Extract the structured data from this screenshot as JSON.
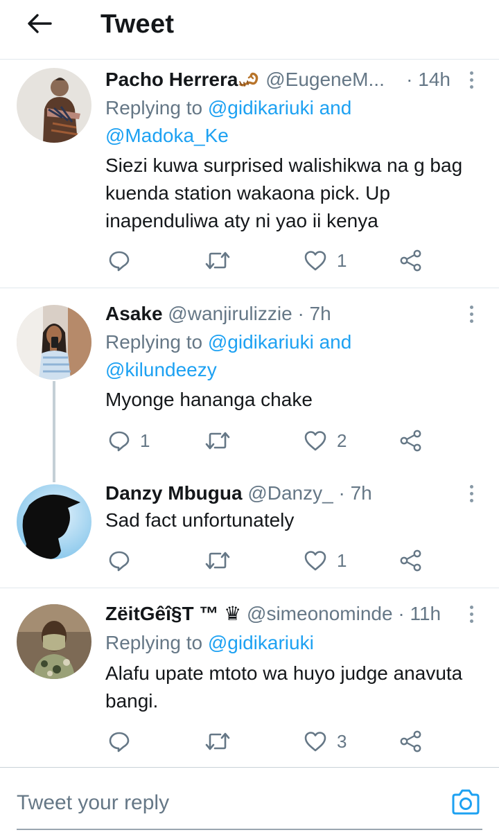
{
  "header": {
    "title": "Tweet",
    "back_icon": "arrow-left-icon"
  },
  "colors": {
    "link": "#1da1f2",
    "secondary_text": "#657786",
    "divider": "#e1e8ed"
  },
  "tweets": [
    {
      "name": "Pacho Herrera",
      "name_emoji": "scorpion-icon",
      "handle": "@EugeneM...",
      "time": "· 14h",
      "replying_prefix": "Replying to",
      "reply_links": [
        "@gidikariuki",
        "and",
        "@Madoka_Ke"
      ],
      "text": "Siezi kuwa surprised walishikwa na g bag kuenda station wakaona pick. Up inapenduliwa aty ni yao ii kenya",
      "counts": {
        "reply": "",
        "retweet": "",
        "like": "1"
      }
    },
    {
      "name": "Asake",
      "handle": "@wanjirulizzie",
      "time": "· 7h",
      "replying_prefix": "Replying to",
      "reply_links": [
        "@gidikariuki",
        "and",
        "@kilundeezy"
      ],
      "text": "Myonge hananga chake",
      "counts": {
        "reply": "1",
        "retweet": "",
        "like": "2"
      }
    },
    {
      "name": "Danzy Mbugua",
      "handle": "@Danzy_",
      "time": "· 7h",
      "text": "Sad fact unfortunately",
      "counts": {
        "reply": "",
        "retweet": "",
        "like": "1"
      }
    },
    {
      "name": "ZëitGêî§T ™ ♛",
      "handle": "@simeonominde",
      "time": "· 11h",
      "replying_prefix": "Replying to",
      "reply_links": [
        "@gidikariuki"
      ],
      "text": "Alafu upate mtoto wa huyo judge anavuta bangi.",
      "counts": {
        "reply": "",
        "retweet": "",
        "like": "3"
      }
    }
  ],
  "composer": {
    "placeholder": "Tweet your reply",
    "camera_icon": "camera-icon"
  }
}
